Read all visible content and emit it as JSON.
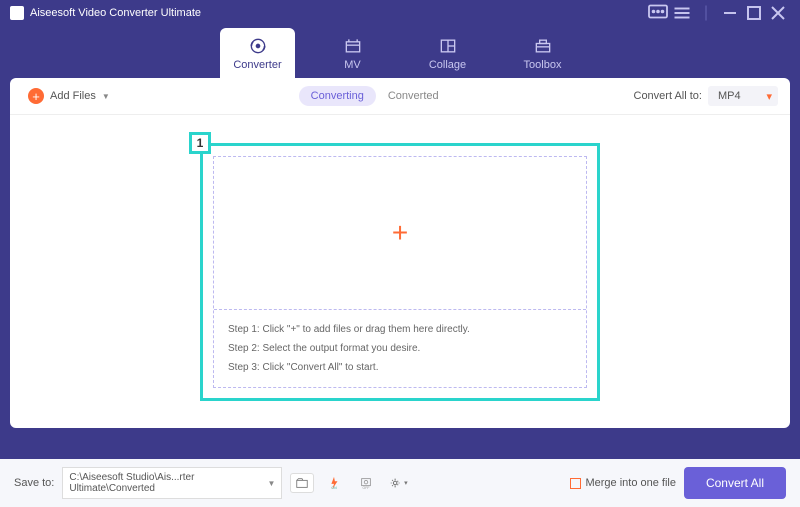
{
  "app_title": "Aiseesoft Video Converter Ultimate",
  "tabs": {
    "converter": "Converter",
    "mv": "MV",
    "collage": "Collage",
    "toolbox": "Toolbox"
  },
  "toolbar": {
    "add_files": "Add Files",
    "converting": "Converting",
    "converted": "Converted",
    "convert_all_to": "Convert All to:",
    "format": "MP4"
  },
  "callout": "1",
  "steps": {
    "s1": "Step 1: Click \"+\" to add files or drag them here directly.",
    "s2": "Step 2: Select the output format you desire.",
    "s3": "Step 3: Click \"Convert All\" to start."
  },
  "footer": {
    "save_to": "Save to:",
    "path": "C:\\Aiseesoft Studio\\Ais...rter Ultimate\\Converted",
    "merge": "Merge into one file",
    "convert_all": "Convert All"
  }
}
